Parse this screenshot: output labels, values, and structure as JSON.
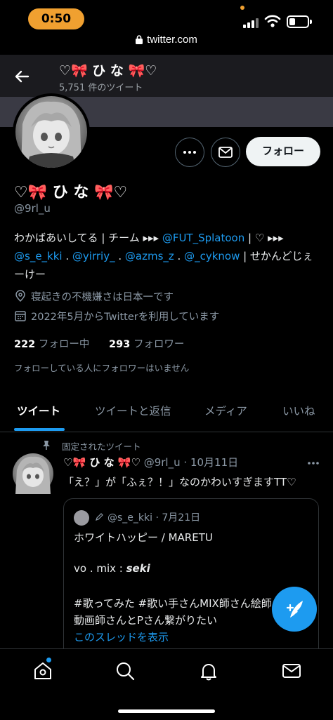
{
  "status_bar": {
    "time": "0:50"
  },
  "browser": {
    "url": "twitter.com"
  },
  "header": {
    "name": "♡🎀 ひ な 🎀♡",
    "tweet_count": "5,751 件のツイート"
  },
  "profile": {
    "name": "♡🎀 ひ な 🎀♡",
    "handle": "@9rl_u",
    "follow_label": "フォロー",
    "bio": {
      "line1_prefix": "わかばあいしてる | チーム ▸▸▸ ",
      "team_link": "@FUT_Splatoon",
      "line1_suffix": " | ♡ ▸▸▸",
      "mention1": "@s_e_kki",
      "sep1": " . ",
      "mention2": "@yirriy_",
      "sep2": " . ",
      "mention3": "@azms_z",
      "sep3": " . ",
      "mention4": "@_cyknow",
      "line2_suffix": " | せかんどじぇ",
      "line3": "ーけー"
    },
    "location": "寝起きの不機嫌さは日本一です",
    "joined": "2022年5月からTwitterを利用しています",
    "following_count": "222",
    "following_label": "フォロー中",
    "followers_count": "293",
    "followers_label": "フォロワー",
    "no_mutual_followers": "フォローしている人にフォロワーはいません"
  },
  "tabs": [
    {
      "label": "ツイート",
      "active": true
    },
    {
      "label": "ツイートと返信",
      "active": false
    },
    {
      "label": "メディア",
      "active": false
    },
    {
      "label": "いいね",
      "active": false
    }
  ],
  "tweet": {
    "pinned_label": "固定されたツイート",
    "author_name": "♡🎀 ひ な 🎀♡",
    "author_handle": "@9rl_u",
    "separator": "·",
    "date": "10月11日",
    "text": "「え？」が「ふぇ？！」なのかわいすぎますTT♡",
    "quote": {
      "handle": "@s_e_kki",
      "separator": "·",
      "date": "7月21日",
      "line1": "ホワイトハッピー / MARETU",
      "line2": "vo . mix : ",
      "line2_name": "seki",
      "line3": "#歌ってみた #歌い手さんMIX師さん絵師",
      "line4": "動画師さんとPさん繋がりたい",
      "show_thread": "このスレッドを表示"
    }
  },
  "colors": {
    "accent": "#1d9bf0",
    "status_pill": "#f0a030",
    "header_bg": "#1b1b1f"
  },
  "icons": [
    "back-arrow-icon",
    "more-icon",
    "mail-icon",
    "location-icon",
    "calendar-icon",
    "pin-icon",
    "compose-icon",
    "home-icon",
    "search-icon",
    "bell-icon",
    "messages-icon"
  ]
}
